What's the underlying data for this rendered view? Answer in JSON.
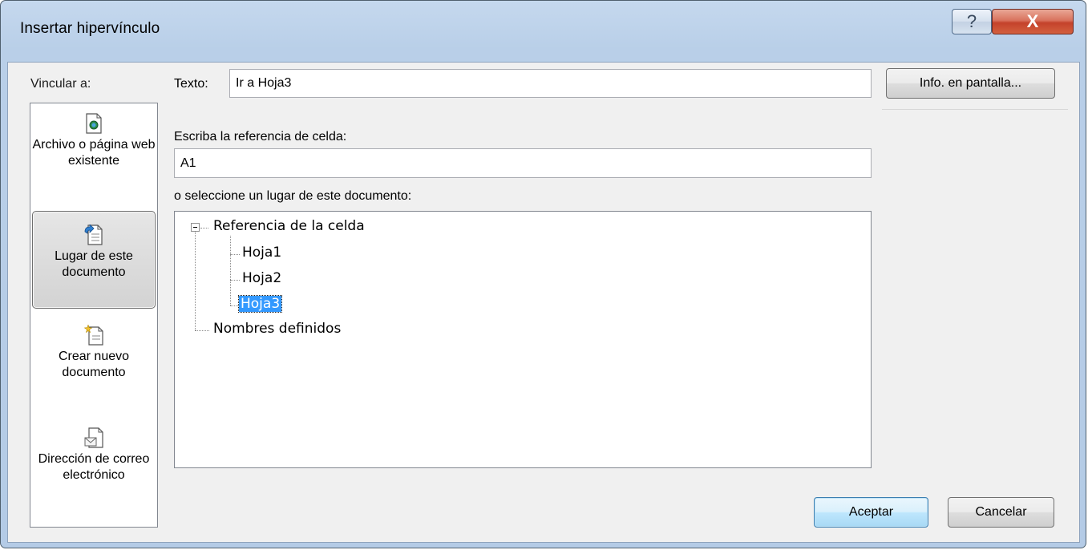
{
  "window": {
    "title": "Insertar hipervínculo",
    "help_glyph": "?",
    "close_glyph": "X"
  },
  "link_to": {
    "label": "Vincular a:",
    "items": [
      {
        "label": "Archivo o página web existente",
        "icon": "existing-file-icon",
        "selected": false
      },
      {
        "label": "Lugar de este documento",
        "icon": "place-in-document-icon",
        "selected": true
      },
      {
        "label": "Crear nuevo documento",
        "icon": "new-document-icon",
        "selected": false
      },
      {
        "label": "Dirección de correo electrónico",
        "icon": "email-address-icon",
        "selected": false
      }
    ]
  },
  "text_field": {
    "label": "Texto:",
    "value": "Ir a Hoja3"
  },
  "screen_tip_button": "Info. en pantalla...",
  "cell_reference": {
    "label": "Escriba la referencia de celda:",
    "value": "A1"
  },
  "place_select_label": "o seleccione un lugar de este documento:",
  "tree": {
    "root": "Referencia de la celda",
    "sheets": [
      "Hoja1",
      "Hoja2",
      "Hoja3"
    ],
    "selected_sheet": "Hoja3",
    "defined_names": "Nombres definidos"
  },
  "buttons": {
    "ok": "Aceptar",
    "cancel": "Cancelar"
  },
  "colors": {
    "selection": "#3399ff",
    "title_bar": "#c5d8ee",
    "close_button": "#c4422b"
  }
}
